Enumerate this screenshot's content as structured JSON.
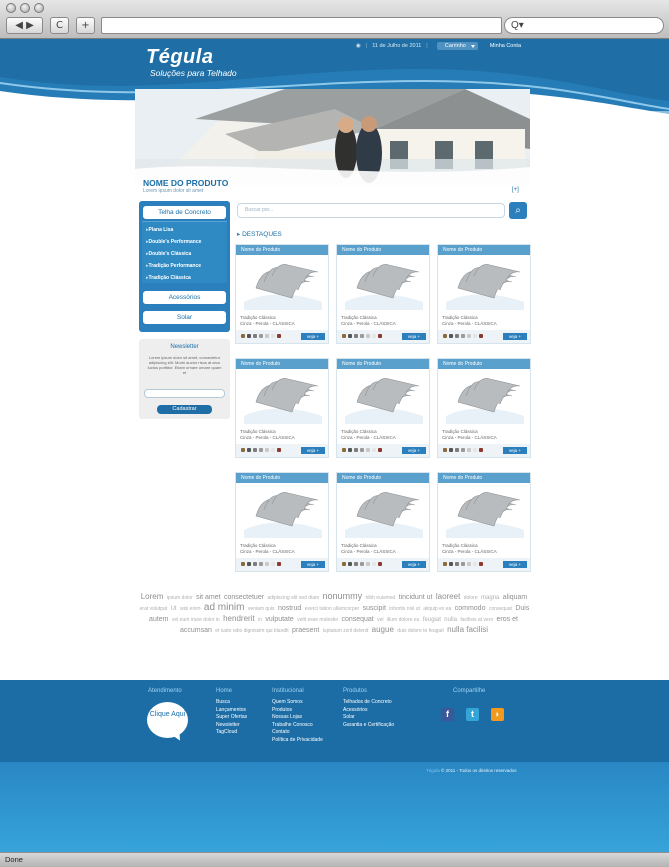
{
  "browser": {
    "back_label": "◀ ▶",
    "reload_label": "C",
    "newtab_label": "+",
    "search_label": "Q▾",
    "status": "Done"
  },
  "header": {
    "logo_name": "Tégula",
    "logo_tagline": "Soluções para Telhado",
    "date": "11 de Julho de 2011",
    "cart": "Carrinho",
    "account": "Minha Conta"
  },
  "product": {
    "title": "NOME DO PRODUTO",
    "subtitle": "Lorem ipsum dolor sit amet",
    "more": "[+]"
  },
  "sidebar": {
    "main_button": "Telha de Concreto",
    "items": [
      "Plana Lisa",
      "Double's Performance",
      "Double's Clássica",
      "Tradição Performance",
      "Tradição Clássica"
    ],
    "acessorios": "Acessórios",
    "solar": "Solar"
  },
  "newsletter": {
    "title": "Newsletter",
    "text": "Lorem ipsum dolor sit amet, consectetur adipiscing elit. Morbi auctor risus at arcu luctus porttitor. Etiam ornare ornare quam et",
    "button": "Cadastrar"
  },
  "search": {
    "placeholder": "Buscar por..."
  },
  "section_title": "DESTAQUES",
  "cards": [
    {
      "title": "Nome do Produto",
      "line1": "Tradição Clássica",
      "line2": "Cinza - Perola - CLÁSSICA",
      "button": "veja +"
    },
    {
      "title": "Nome do Produto",
      "line1": "Tradição Clássica",
      "line2": "Cinza - Perola - CLÁSSICA",
      "button": "veja +"
    },
    {
      "title": "Nome do Produto",
      "line1": "Tradição Clássica",
      "line2": "Cinza - Perola - CLÁSSICA",
      "button": "veja +"
    },
    {
      "title": "Nome do Produto",
      "line1": "Tradição Clássica",
      "line2": "Cinza - Perola - CLÁSSICA",
      "button": "veja +"
    },
    {
      "title": "Nome do Produto",
      "line1": "Tradição Clássica",
      "line2": "Cinza - Perola - CLÁSSICA",
      "button": "veja +"
    },
    {
      "title": "Nome do Produto",
      "line1": "Tradição Clássica",
      "line2": "Cinza - Perola - CLÁSSICA",
      "button": "veja +"
    },
    {
      "title": "Nome do Produto",
      "line1": "Tradição Clássica",
      "line2": "Cinza - Perola - CLÁSSICA",
      "button": "veja +"
    },
    {
      "title": "Nome do Produto",
      "line1": "Tradição Clássica",
      "line2": "Cinza - Perola - CLÁSSICA",
      "button": "veja +"
    },
    {
      "title": "Nome do Produto",
      "line1": "Tradição Clássica",
      "line2": "Cinza - Perola - CLÁSSICA",
      "button": "veja +"
    }
  ],
  "swatch_colors": [
    "#8c6a3e",
    "#555555",
    "#7d7d7d",
    "#9a9a9a",
    "#c9c9c9",
    "#e6e6e6",
    "#8a3a2e"
  ],
  "tags": [
    {
      "t": "Lorem",
      "s": 8
    },
    {
      "t": "ipsum dolor",
      "s": 5
    },
    {
      "t": "sit amet",
      "s": 7
    },
    {
      "t": "consectetuer",
      "s": 7
    },
    {
      "t": "adipiscing elit sed diam",
      "s": 5
    },
    {
      "t": "nonummy",
      "s": 9
    },
    {
      "t": "nibh euismod",
      "s": 5
    },
    {
      "t": "tincidunt ut",
      "s": 7
    },
    {
      "t": "laoreet",
      "s": 8
    },
    {
      "t": "dolore",
      "s": 5
    },
    {
      "t": "magna",
      "s": 6
    },
    {
      "t": "aliquam",
      "s": 7
    },
    {
      "t": "erat volutpat",
      "s": 5
    },
    {
      "t": "Ut",
      "s": 6
    },
    {
      "t": "wisi enim",
      "s": 5
    },
    {
      "t": "ad minim",
      "s": 10
    },
    {
      "t": "veniam quis",
      "s": 5
    },
    {
      "t": "nostrud",
      "s": 7
    },
    {
      "t": "exerci tation ullamcorper",
      "s": 5
    },
    {
      "t": "suscipit",
      "s": 7
    },
    {
      "t": "lobortis nisl ut",
      "s": 5
    },
    {
      "t": "aliquip ex ea",
      "s": 5
    },
    {
      "t": "commodo",
      "s": 7
    },
    {
      "t": "consequat",
      "s": 5
    },
    {
      "t": "Duis autem",
      "s": 7
    },
    {
      "t": "vel eum iriure dolor in",
      "s": 5
    },
    {
      "t": "hendrerit",
      "s": 8
    },
    {
      "t": "in",
      "s": 5
    },
    {
      "t": "vulputate",
      "s": 7
    },
    {
      "t": "velit esse molestie",
      "s": 5
    },
    {
      "t": "consequat",
      "s": 7
    },
    {
      "t": "vel",
      "s": 5
    },
    {
      "t": "illum dolore eu",
      "s": 5
    },
    {
      "t": "feugiat",
      "s": 6
    },
    {
      "t": "nulla",
      "s": 6
    },
    {
      "t": "facilisis at vero",
      "s": 5
    },
    {
      "t": "eros et",
      "s": 7
    },
    {
      "t": "accumsan",
      "s": 7
    },
    {
      "t": "et iusto odio dignissim qui blandit",
      "s": 5
    },
    {
      "t": "praesent",
      "s": 7
    },
    {
      "t": "luptatum zzril delenit",
      "s": 5
    },
    {
      "t": "augue",
      "s": 8
    },
    {
      "t": "duis dolore te feugait",
      "s": 5
    },
    {
      "t": "nulla facilisi",
      "s": 8
    }
  ],
  "footer": {
    "atendimento": "Atendimento",
    "bubble": "Clique Aqui",
    "home_title": "Home",
    "home_links": [
      "Busca",
      "Lançamentos",
      "Super Ofertas",
      "Newsletter",
      "TagCloud"
    ],
    "inst_title": "Institucional",
    "inst_links": [
      "Quem Somos",
      "Produtos",
      "Nossas Lojas",
      "Trabalhe Conosco",
      "Contato",
      "Política de Privacidade"
    ],
    "prod_title": "Produtos",
    "prod_links": [
      "Telhados de Concreto",
      "Acessórios",
      "Solar",
      "Garantia e Certificação"
    ],
    "share_title": "Compartilhe",
    "social": [
      {
        "icon": "facebook-icon",
        "glyph": "f",
        "color": "#3b5998"
      },
      {
        "icon": "twitter-icon",
        "glyph": "t",
        "color": "#33a5d8"
      },
      {
        "icon": "rss-icon",
        "glyph": "◗",
        "color": "#f39a1e"
      }
    ],
    "copyright_brand": "Tégula",
    "copyright": "© 2011 - Todos os direitos reservados"
  }
}
